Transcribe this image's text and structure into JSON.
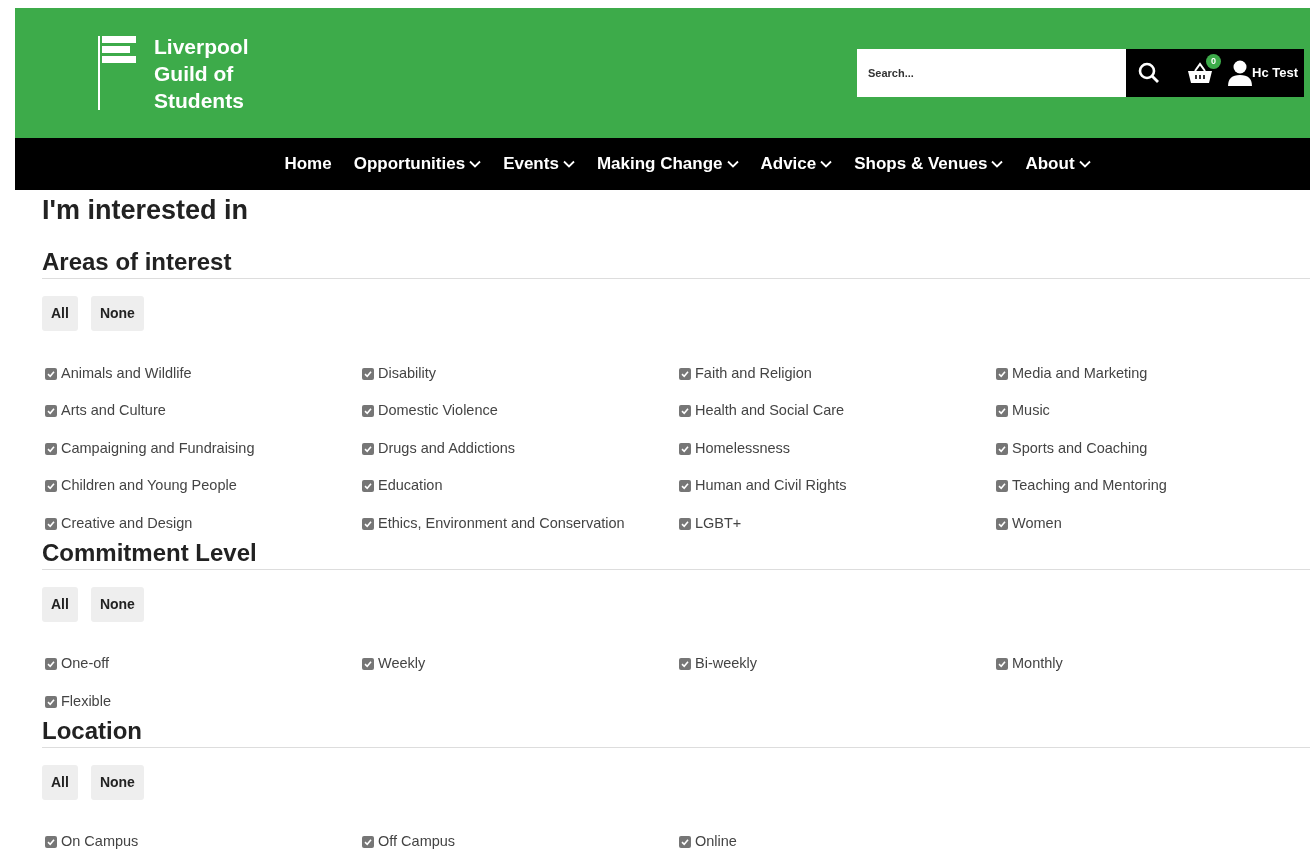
{
  "header": {
    "logo_lines": [
      "Liverpool",
      "Guild of",
      "Students"
    ],
    "search": {
      "placeholder": "Search..."
    },
    "cart_count": "0",
    "user": "Hc Test"
  },
  "nav": [
    {
      "label": "Home",
      "dropdown": false
    },
    {
      "label": "Opportunities",
      "dropdown": true
    },
    {
      "label": "Events",
      "dropdown": true
    },
    {
      "label": "Making Change",
      "dropdown": true
    },
    {
      "label": "Advice",
      "dropdown": true
    },
    {
      "label": "Shops & Venues",
      "dropdown": true
    },
    {
      "label": "About",
      "dropdown": true
    }
  ],
  "title": "I'm interested in",
  "sections": [
    {
      "heading": "Areas of interest",
      "buttons": [
        "All",
        "None"
      ],
      "options": [
        {
          "label": "Animals and Wildlife",
          "checked": true
        },
        {
          "label": "Disability",
          "checked": true
        },
        {
          "label": "Faith and Religion",
          "checked": true
        },
        {
          "label": "Media and Marketing",
          "checked": true
        },
        {
          "label": "Arts and Culture",
          "checked": true
        },
        {
          "label": "Domestic Violence",
          "checked": true
        },
        {
          "label": "Health and Social Care",
          "checked": true
        },
        {
          "label": "Music",
          "checked": true
        },
        {
          "label": "Campaigning and Fundraising",
          "checked": true
        },
        {
          "label": "Drugs and Addictions",
          "checked": true
        },
        {
          "label": "Homelessness",
          "checked": true
        },
        {
          "label": "Sports and Coaching",
          "checked": true
        },
        {
          "label": "Children and Young People",
          "checked": true
        },
        {
          "label": "Education",
          "checked": true
        },
        {
          "label": "Human and Civil Rights",
          "checked": true
        },
        {
          "label": "Teaching and Mentoring",
          "checked": true
        },
        {
          "label": "Creative and Design",
          "checked": true
        },
        {
          "label": "Ethics, Environment and Conservation",
          "checked": true
        },
        {
          "label": "LGBT+",
          "checked": true
        },
        {
          "label": "Women",
          "checked": true
        }
      ]
    },
    {
      "heading": "Commitment Level",
      "buttons": [
        "All",
        "None"
      ],
      "options": [
        {
          "label": "One-off",
          "checked": true
        },
        {
          "label": "Weekly",
          "checked": true
        },
        {
          "label": "Bi-weekly",
          "checked": true
        },
        {
          "label": "Monthly",
          "checked": true
        },
        {
          "label": "Flexible",
          "checked": true
        }
      ]
    },
    {
      "heading": "Location",
      "buttons": [
        "All",
        "None"
      ],
      "options": [
        {
          "label": "On Campus",
          "checked": true
        },
        {
          "label": "Off Campus",
          "checked": true
        },
        {
          "label": "Online",
          "checked": true
        }
      ]
    }
  ]
}
